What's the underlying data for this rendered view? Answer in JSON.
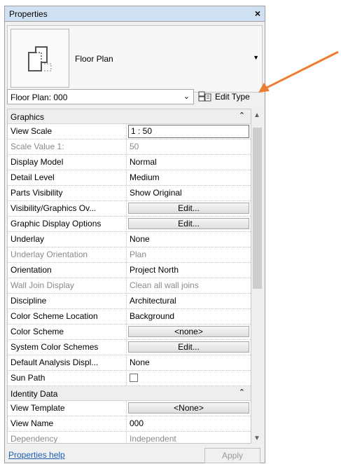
{
  "window": {
    "title": "Properties",
    "close_glyph": "×"
  },
  "type_selector": {
    "type_name": "Floor Plan",
    "thumb_icon": "floor-plan-icon",
    "dropdown_icon": "dropdown-triangle-icon"
  },
  "instance_bar": {
    "selected": "Floor Plan: 000",
    "chevron": "⌄",
    "edit_type_label": "Edit Type",
    "edit_type_icon": "edit-type-icon"
  },
  "groups": [
    {
      "label": "Graphics",
      "collapse_glyph": "⌃",
      "rows": [
        {
          "key": "View Scale",
          "value": "1 : 50",
          "kind": "input"
        },
        {
          "key": "Scale Value    1:",
          "value": "50",
          "kind": "text",
          "disabled": true
        },
        {
          "key": "Display Model",
          "value": "Normal",
          "kind": "text"
        },
        {
          "key": "Detail Level",
          "value": "Medium",
          "kind": "text"
        },
        {
          "key": "Parts Visibility",
          "value": "Show Original",
          "kind": "text"
        },
        {
          "key": "Visibility/Graphics Ov...",
          "value": "Edit...",
          "kind": "button"
        },
        {
          "key": "Graphic Display Options",
          "value": "Edit...",
          "kind": "button"
        },
        {
          "key": "Underlay",
          "value": "None",
          "kind": "text"
        },
        {
          "key": "Underlay Orientation",
          "value": "Plan",
          "kind": "text",
          "disabled": true
        },
        {
          "key": "Orientation",
          "value": "Project North",
          "kind": "text"
        },
        {
          "key": "Wall Join Display",
          "value": "Clean all wall joins",
          "kind": "text",
          "disabled": true
        },
        {
          "key": "Discipline",
          "value": "Architectural",
          "kind": "text"
        },
        {
          "key": "Color Scheme Location",
          "value": "Background",
          "kind": "text"
        },
        {
          "key": "Color Scheme",
          "value": "<none>",
          "kind": "button"
        },
        {
          "key": "System Color Schemes",
          "value": "Edit...",
          "kind": "button"
        },
        {
          "key": "Default Analysis Displ...",
          "value": "None",
          "kind": "text"
        },
        {
          "key": "Sun Path",
          "value": "",
          "kind": "checkbox"
        }
      ]
    },
    {
      "label": "Identity Data",
      "collapse_glyph": "⌃",
      "rows": [
        {
          "key": "View Template",
          "value": "<None>",
          "kind": "button"
        },
        {
          "key": "View Name",
          "value": "000",
          "kind": "text"
        },
        {
          "key": "Dependency",
          "value": "Independent",
          "kind": "text",
          "disabled": true
        }
      ]
    }
  ],
  "scrollbar": {
    "up_glyph": "▲",
    "down_glyph": "▼"
  },
  "footer": {
    "help_link": "Properties help",
    "apply_label": "Apply"
  },
  "colors": {
    "annotation_arrow": "#ed7d31",
    "titlebar": "#cfe0f2",
    "link": "#1a5fb4"
  }
}
